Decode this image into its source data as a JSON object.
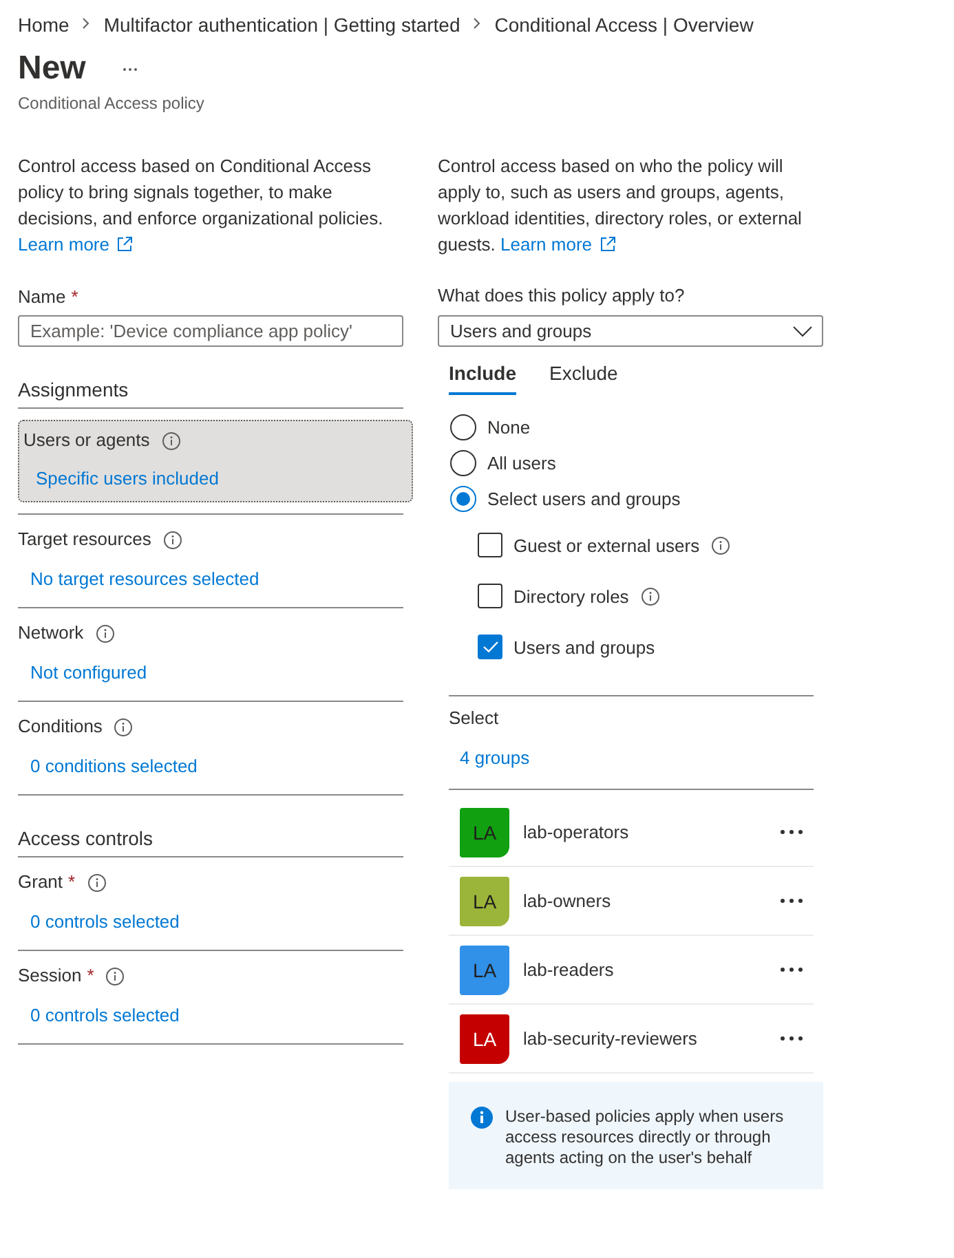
{
  "breadcrumb": [
    {
      "label": "Home"
    },
    {
      "label": "Multifactor authentication | Getting started"
    },
    {
      "label": "Conditional Access | Overview"
    }
  ],
  "header": {
    "title": "New",
    "subtitle": "Conditional Access policy"
  },
  "left": {
    "description": {
      "text": "Control access based on Conditional Access policy to bring signals together, to make decisions, and enforce organizational policies.",
      "link": "Learn more"
    },
    "name_field": {
      "label": "Name",
      "required_mark": "*",
      "placeholder": "Example: 'Device compliance app policy'"
    },
    "sections": [
      {
        "heading": "Assignments",
        "items": [
          {
            "label": "Users or agents",
            "info": true,
            "value": "Specific users included",
            "selected": true
          },
          {
            "label": "Target resources",
            "info": true,
            "value": "No target resources selected",
            "selected": false
          },
          {
            "label": "Network",
            "info": true,
            "value": "Not configured",
            "selected": false
          },
          {
            "label": "Conditions",
            "info": true,
            "value": "0 conditions selected",
            "selected": false
          }
        ]
      },
      {
        "heading": "Access controls",
        "items": [
          {
            "label": "Grant",
            "required_mark": "*",
            "info": true,
            "value": "0 controls selected",
            "selected": false
          },
          {
            "label": "Session",
            "required_mark": "*",
            "info": true,
            "value": "0 controls selected",
            "selected": false
          }
        ]
      }
    ]
  },
  "right": {
    "description": {
      "text": "Control access based on who the policy will apply to, such as users and groups, agents, workload identities, directory roles, or external guests.",
      "link": "Learn more"
    },
    "apply_to": {
      "label": "What does this policy apply to?",
      "value": "Users and groups"
    },
    "tabs": [
      {
        "label": "Include",
        "selected": true
      },
      {
        "label": "Exclude",
        "selected": false
      }
    ],
    "radios": [
      {
        "label": "None",
        "selected": false
      },
      {
        "label": "All users",
        "selected": false
      },
      {
        "label": "Select users and groups",
        "selected": true
      }
    ],
    "checkboxes": [
      {
        "label": "Guest or external users",
        "checked": false,
        "info": true
      },
      {
        "label": "Directory roles",
        "checked": false,
        "info": true
      },
      {
        "label": "Users and groups",
        "checked": true,
        "info": false
      }
    ],
    "select": {
      "label": "Select",
      "value": "4 groups"
    },
    "groups": [
      {
        "initials": "LA",
        "name": "lab-operators",
        "color": "#10a010"
      },
      {
        "initials": "LA",
        "name": "lab-owners",
        "color": "#9bb43a"
      },
      {
        "initials": "LA",
        "name": "lab-readers",
        "color": "#3190e8"
      },
      {
        "initials": "LA",
        "name": "lab-security-reviewers",
        "color": "#c40000"
      }
    ],
    "notice": {
      "text": "User-based policies apply when users access resources directly or through agents acting on the user's behalf"
    }
  }
}
